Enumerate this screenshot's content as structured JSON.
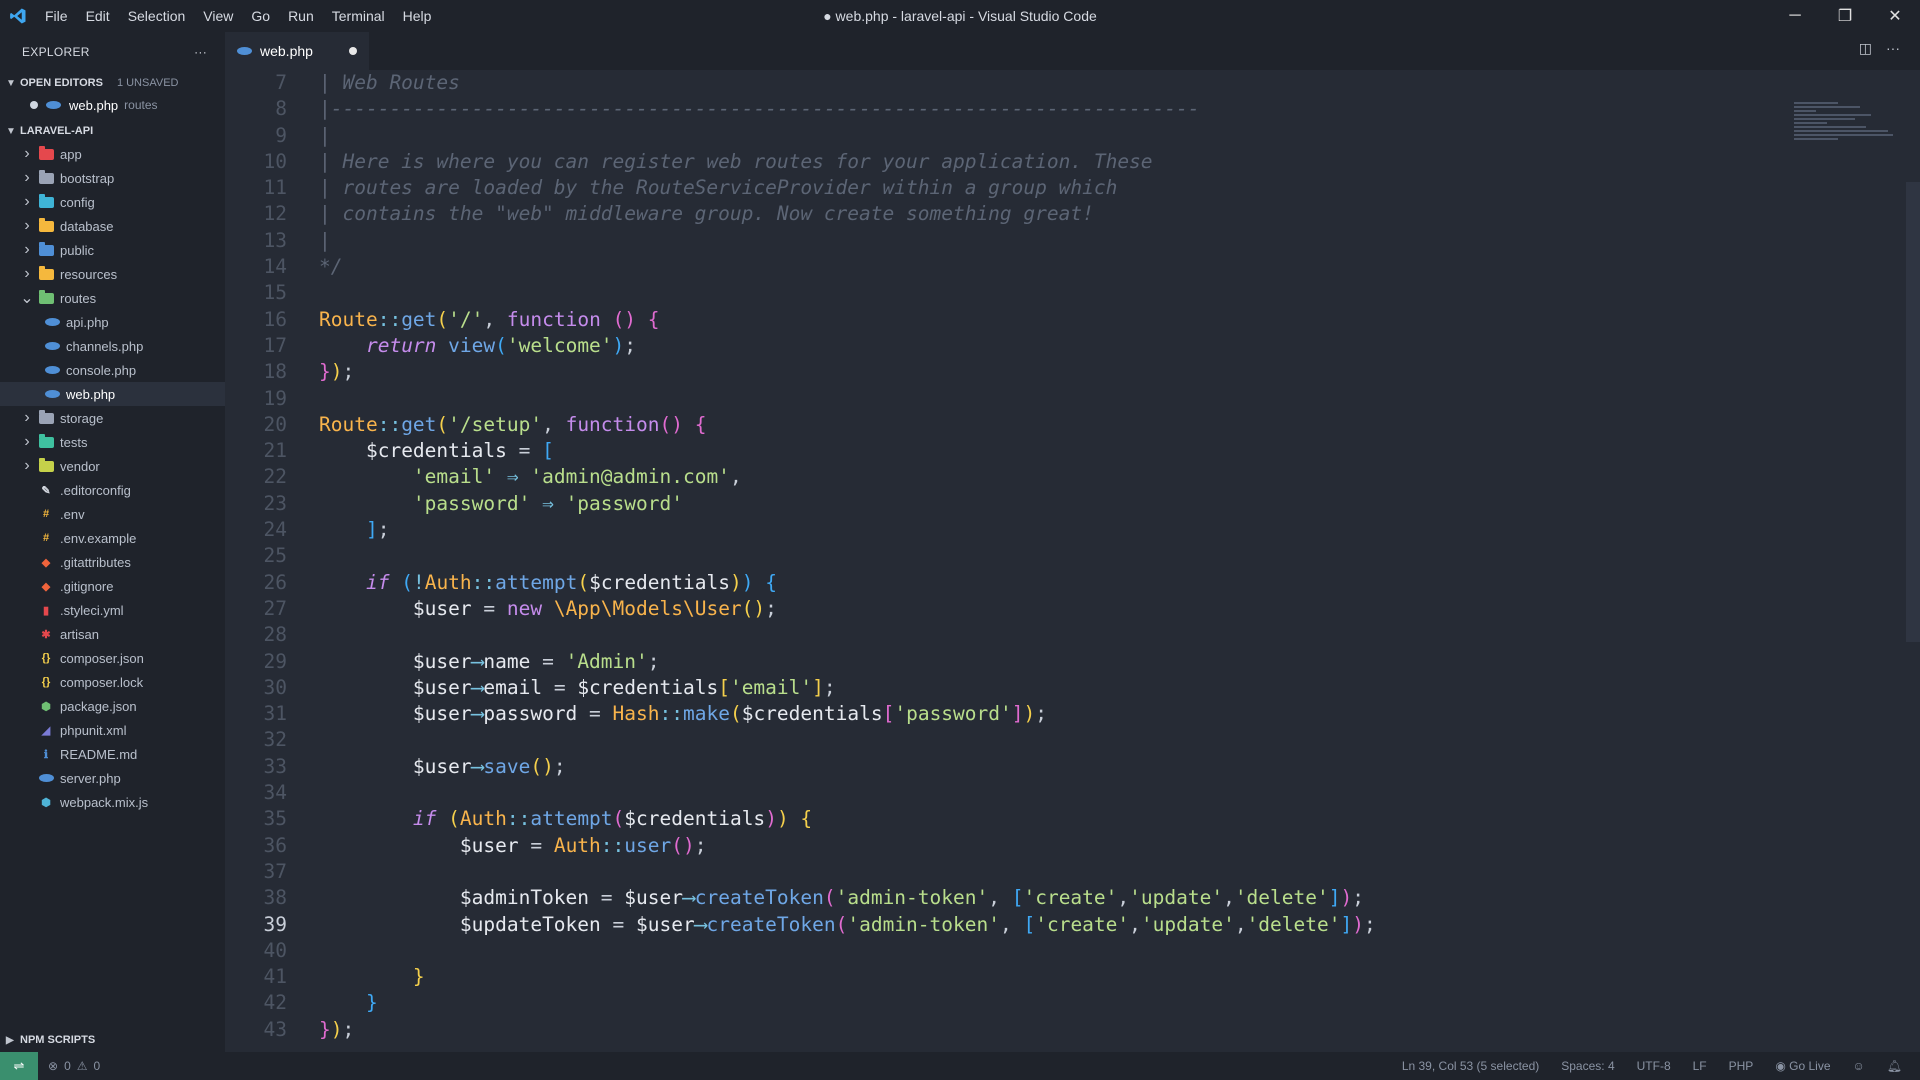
{
  "window": {
    "title": "● web.php - laravel-api - Visual Studio Code",
    "menu": [
      "File",
      "Edit",
      "Selection",
      "View",
      "Go",
      "Run",
      "Terminal",
      "Help"
    ],
    "controls": {
      "minimize": "─",
      "restore": "❐",
      "close": "✕"
    }
  },
  "sidebar": {
    "header": "EXPLORER",
    "more": "···",
    "open_editors": {
      "label": "OPEN EDITORS",
      "badge": "1 UNSAVED",
      "file": "web.php",
      "desc": "routes"
    },
    "project": "LARAVEL-API",
    "tree": [
      {
        "name": "app",
        "kind": "folder",
        "color": "#e5484d"
      },
      {
        "name": "bootstrap",
        "kind": "folder",
        "color": "#9aa3b5"
      },
      {
        "name": "config",
        "kind": "folder",
        "color": "#3fb4d6"
      },
      {
        "name": "database",
        "kind": "folder",
        "color": "#f5b83d"
      },
      {
        "name": "public",
        "kind": "folder",
        "color": "#4f8fd6"
      },
      {
        "name": "resources",
        "kind": "folder",
        "color": "#f5b83d"
      },
      {
        "name": "routes",
        "kind": "folder-open",
        "color": "#6fbf73"
      },
      {
        "name": "api.php",
        "kind": "php"
      },
      {
        "name": "channels.php",
        "kind": "php"
      },
      {
        "name": "console.php",
        "kind": "php"
      },
      {
        "name": "web.php",
        "kind": "php",
        "selected": true
      },
      {
        "name": "storage",
        "kind": "folder",
        "color": "#9aa3b5"
      },
      {
        "name": "tests",
        "kind": "folder",
        "color": "#3fc1a0"
      },
      {
        "name": "vendor",
        "kind": "folder",
        "color": "#c5d14a"
      },
      {
        "name": ".editorconfig",
        "kind": "file",
        "glyph": "✎",
        "color": "#d6dae2"
      },
      {
        "name": ".env",
        "kind": "file",
        "glyph": "#",
        "color": "#f5b83d"
      },
      {
        "name": ".env.example",
        "kind": "file",
        "glyph": "#",
        "color": "#f5b83d"
      },
      {
        "name": ".gitattributes",
        "kind": "file",
        "glyph": "◆",
        "color": "#f0643c"
      },
      {
        "name": ".gitignore",
        "kind": "file",
        "glyph": "◆",
        "color": "#f0643c"
      },
      {
        "name": ".styleci.yml",
        "kind": "file",
        "glyph": "▮",
        "color": "#e5484d"
      },
      {
        "name": "artisan",
        "kind": "file",
        "glyph": "✱",
        "color": "#e5484d"
      },
      {
        "name": "composer.json",
        "kind": "file",
        "glyph": "{}",
        "color": "#f5d04c"
      },
      {
        "name": "composer.lock",
        "kind": "file",
        "glyph": "{}",
        "color": "#f5d04c"
      },
      {
        "name": "package.json",
        "kind": "file",
        "glyph": "⬢",
        "color": "#6fbf73"
      },
      {
        "name": "phpunit.xml",
        "kind": "file",
        "glyph": "◢",
        "color": "#7b7bd6"
      },
      {
        "name": "README.md",
        "kind": "file",
        "glyph": "ℹ",
        "color": "#4f8fd6"
      },
      {
        "name": "server.php",
        "kind": "php"
      },
      {
        "name": "webpack.mix.js",
        "kind": "file",
        "glyph": "⬢",
        "color": "#4fb3d6"
      }
    ],
    "npm": "NPM SCRIPTS"
  },
  "editor": {
    "tab": "web.php",
    "first_line_number": 7,
    "current_line": 39,
    "lines": [
      [
        [
          "cmt",
          "| Web Routes"
        ]
      ],
      [
        [
          "cmt",
          "|--------------------------------------------------------------------------"
        ]
      ],
      [
        [
          "cmt",
          "|"
        ]
      ],
      [
        [
          "cmt",
          "| Here is where you can register web routes for your application. These"
        ]
      ],
      [
        [
          "cmt",
          "| routes are loaded by the RouteServiceProvider within a group which"
        ]
      ],
      [
        [
          "cmt",
          "| contains the \"web\" middleware group. Now create something great!"
        ]
      ],
      [
        [
          "cmt",
          "|"
        ]
      ],
      [
        [
          "cmt",
          "*/"
        ]
      ],
      [],
      [
        [
          "kw-cls",
          "Route"
        ],
        [
          "op",
          "::"
        ],
        [
          "fn",
          "get"
        ],
        [
          "br1",
          "("
        ],
        [
          "str",
          "'/'"
        ],
        [
          "pun",
          ", "
        ],
        [
          "kw",
          "function "
        ],
        [
          "br2",
          "() {"
        ]
      ],
      [
        [
          "pun",
          "    "
        ],
        [
          "kwi",
          "return "
        ],
        [
          "fn",
          "view"
        ],
        [
          "br3",
          "("
        ],
        [
          "str",
          "'welcome'"
        ],
        [
          "br3",
          ")"
        ],
        [
          "pun",
          ";"
        ]
      ],
      [
        [
          "br2",
          "}"
        ],
        [
          "br1",
          ")"
        ],
        [
          "pun",
          ";"
        ]
      ],
      [],
      [
        [
          "kw-cls",
          "Route"
        ],
        [
          "op",
          "::"
        ],
        [
          "fn",
          "get"
        ],
        [
          "br1",
          "("
        ],
        [
          "str",
          "'/setup'"
        ],
        [
          "pun",
          ", "
        ],
        [
          "kw",
          "function"
        ],
        [
          "br2",
          "() {"
        ]
      ],
      [
        [
          "pun",
          "    "
        ],
        [
          "var",
          "$credentials"
        ],
        [
          "pun",
          " = "
        ],
        [
          "br3",
          "["
        ]
      ],
      [
        [
          "pun",
          "        "
        ],
        [
          "str",
          "'email'"
        ],
        [
          "op",
          " ⇒ "
        ],
        [
          "str",
          "'admin@admin.com'"
        ],
        [
          "pun",
          ","
        ]
      ],
      [
        [
          "pun",
          "        "
        ],
        [
          "str",
          "'password'"
        ],
        [
          "op",
          " ⇒ "
        ],
        [
          "str",
          "'password'"
        ]
      ],
      [
        [
          "pun",
          "    "
        ],
        [
          "br3",
          "]"
        ],
        [
          "pun",
          ";"
        ]
      ],
      [],
      [
        [
          "pun",
          "    "
        ],
        [
          "kwi",
          "if "
        ],
        [
          "br3",
          "("
        ],
        [
          "op",
          "!"
        ],
        [
          "kw-cls",
          "Auth"
        ],
        [
          "op",
          "::"
        ],
        [
          "fn",
          "attempt"
        ],
        [
          "br1",
          "("
        ],
        [
          "var",
          "$credentials"
        ],
        [
          "br1",
          ")"
        ],
        [
          "br3",
          ")"
        ],
        [
          "br3",
          " {"
        ]
      ],
      [
        [
          "pun",
          "        "
        ],
        [
          "var",
          "$user"
        ],
        [
          "pun",
          " = "
        ],
        [
          "kw",
          "new "
        ],
        [
          "kw-cls",
          "\\App\\Models\\User"
        ],
        [
          "br1",
          "()"
        ],
        [
          "pun",
          ";"
        ]
      ],
      [],
      [
        [
          "pun",
          "        "
        ],
        [
          "var",
          "$user"
        ],
        [
          "op",
          "⟶"
        ],
        [
          "var",
          "name"
        ],
        [
          "pun",
          " = "
        ],
        [
          "str",
          "'Admin'"
        ],
        [
          "pun",
          ";"
        ]
      ],
      [
        [
          "pun",
          "        "
        ],
        [
          "var",
          "$user"
        ],
        [
          "op",
          "⟶"
        ],
        [
          "var",
          "email"
        ],
        [
          "pun",
          " = "
        ],
        [
          "var",
          "$credentials"
        ],
        [
          "br1",
          "["
        ],
        [
          "str",
          "'email'"
        ],
        [
          "br1",
          "]"
        ],
        [
          "pun",
          ";"
        ]
      ],
      [
        [
          "pun",
          "        "
        ],
        [
          "var",
          "$user"
        ],
        [
          "op",
          "⟶"
        ],
        [
          "var",
          "password"
        ],
        [
          "pun",
          " = "
        ],
        [
          "kw-cls",
          "Hash"
        ],
        [
          "op",
          "::"
        ],
        [
          "fn",
          "make"
        ],
        [
          "br1",
          "("
        ],
        [
          "var",
          "$credentials"
        ],
        [
          "br2",
          "["
        ],
        [
          "str",
          "'password'"
        ],
        [
          "br2",
          "]"
        ],
        [
          "br1",
          ")"
        ],
        [
          "pun",
          ";"
        ]
      ],
      [],
      [
        [
          "pun",
          "        "
        ],
        [
          "var",
          "$user"
        ],
        [
          "op",
          "⟶"
        ],
        [
          "fn",
          "save"
        ],
        [
          "br1",
          "()"
        ],
        [
          "pun",
          ";"
        ]
      ],
      [],
      [
        [
          "pun",
          "        "
        ],
        [
          "kwi",
          "if "
        ],
        [
          "br1",
          "("
        ],
        [
          "kw-cls",
          "Auth"
        ],
        [
          "op",
          "::"
        ],
        [
          "fn",
          "attempt"
        ],
        [
          "br2",
          "("
        ],
        [
          "var",
          "$credentials"
        ],
        [
          "br2",
          ")"
        ],
        [
          "br1",
          ")"
        ],
        [
          "br1",
          " {"
        ]
      ],
      [
        [
          "pun",
          "            "
        ],
        [
          "var",
          "$user"
        ],
        [
          "pun",
          " = "
        ],
        [
          "kw-cls",
          "Auth"
        ],
        [
          "op",
          "::"
        ],
        [
          "fn",
          "user"
        ],
        [
          "br2",
          "()"
        ],
        [
          "pun",
          ";"
        ]
      ],
      [],
      [
        [
          "pun",
          "            "
        ],
        [
          "var",
          "$adminToken"
        ],
        [
          "pun",
          " = "
        ],
        [
          "var",
          "$user"
        ],
        [
          "op",
          "⟶"
        ],
        [
          "fn",
          "createToken"
        ],
        [
          "br2",
          "("
        ],
        [
          "str",
          "'admin-token'"
        ],
        [
          "pun",
          ", "
        ],
        [
          "br3",
          "["
        ],
        [
          "str",
          "'create'"
        ],
        [
          "pun",
          ","
        ],
        [
          "str",
          "'update'"
        ],
        [
          "pun",
          ","
        ],
        [
          "str",
          "'delete'"
        ],
        [
          "br3",
          "]"
        ],
        [
          "br2",
          ")"
        ],
        [
          "pun",
          ";"
        ]
      ],
      [
        [
          "pun",
          "            "
        ],
        [
          "var",
          "$updateToken"
        ],
        [
          "pun",
          " = "
        ],
        [
          "var",
          "$user"
        ],
        [
          "op",
          "⟶"
        ],
        [
          "fn",
          "createToken"
        ],
        [
          "br2",
          "("
        ],
        [
          "str",
          "'admin-token'"
        ],
        [
          "pun",
          ", "
        ],
        [
          "br3",
          "["
        ],
        [
          "str",
          "'create'"
        ],
        [
          "pun",
          ","
        ],
        [
          "str",
          "'update'"
        ],
        [
          "pun",
          ","
        ],
        [
          "str",
          "'delete'"
        ],
        [
          "br3",
          "]"
        ],
        [
          "br2",
          ")"
        ],
        [
          "pun",
          ";"
        ]
      ],
      [],
      [
        [
          "pun",
          "        "
        ],
        [
          "br1",
          "}"
        ]
      ],
      [
        [
          "pun",
          "    "
        ],
        [
          "br3",
          "}"
        ]
      ],
      [
        [
          "br2",
          "}"
        ],
        [
          "br1",
          ")"
        ],
        [
          "pun",
          ";"
        ]
      ]
    ]
  },
  "statusbar": {
    "errors": "0",
    "warnings": "0",
    "position": "Ln 39, Col 53 (5 selected)",
    "spaces": "Spaces: 4",
    "encoding": "UTF-8",
    "eol": "LF",
    "language": "PHP",
    "golive": "Go Live"
  }
}
